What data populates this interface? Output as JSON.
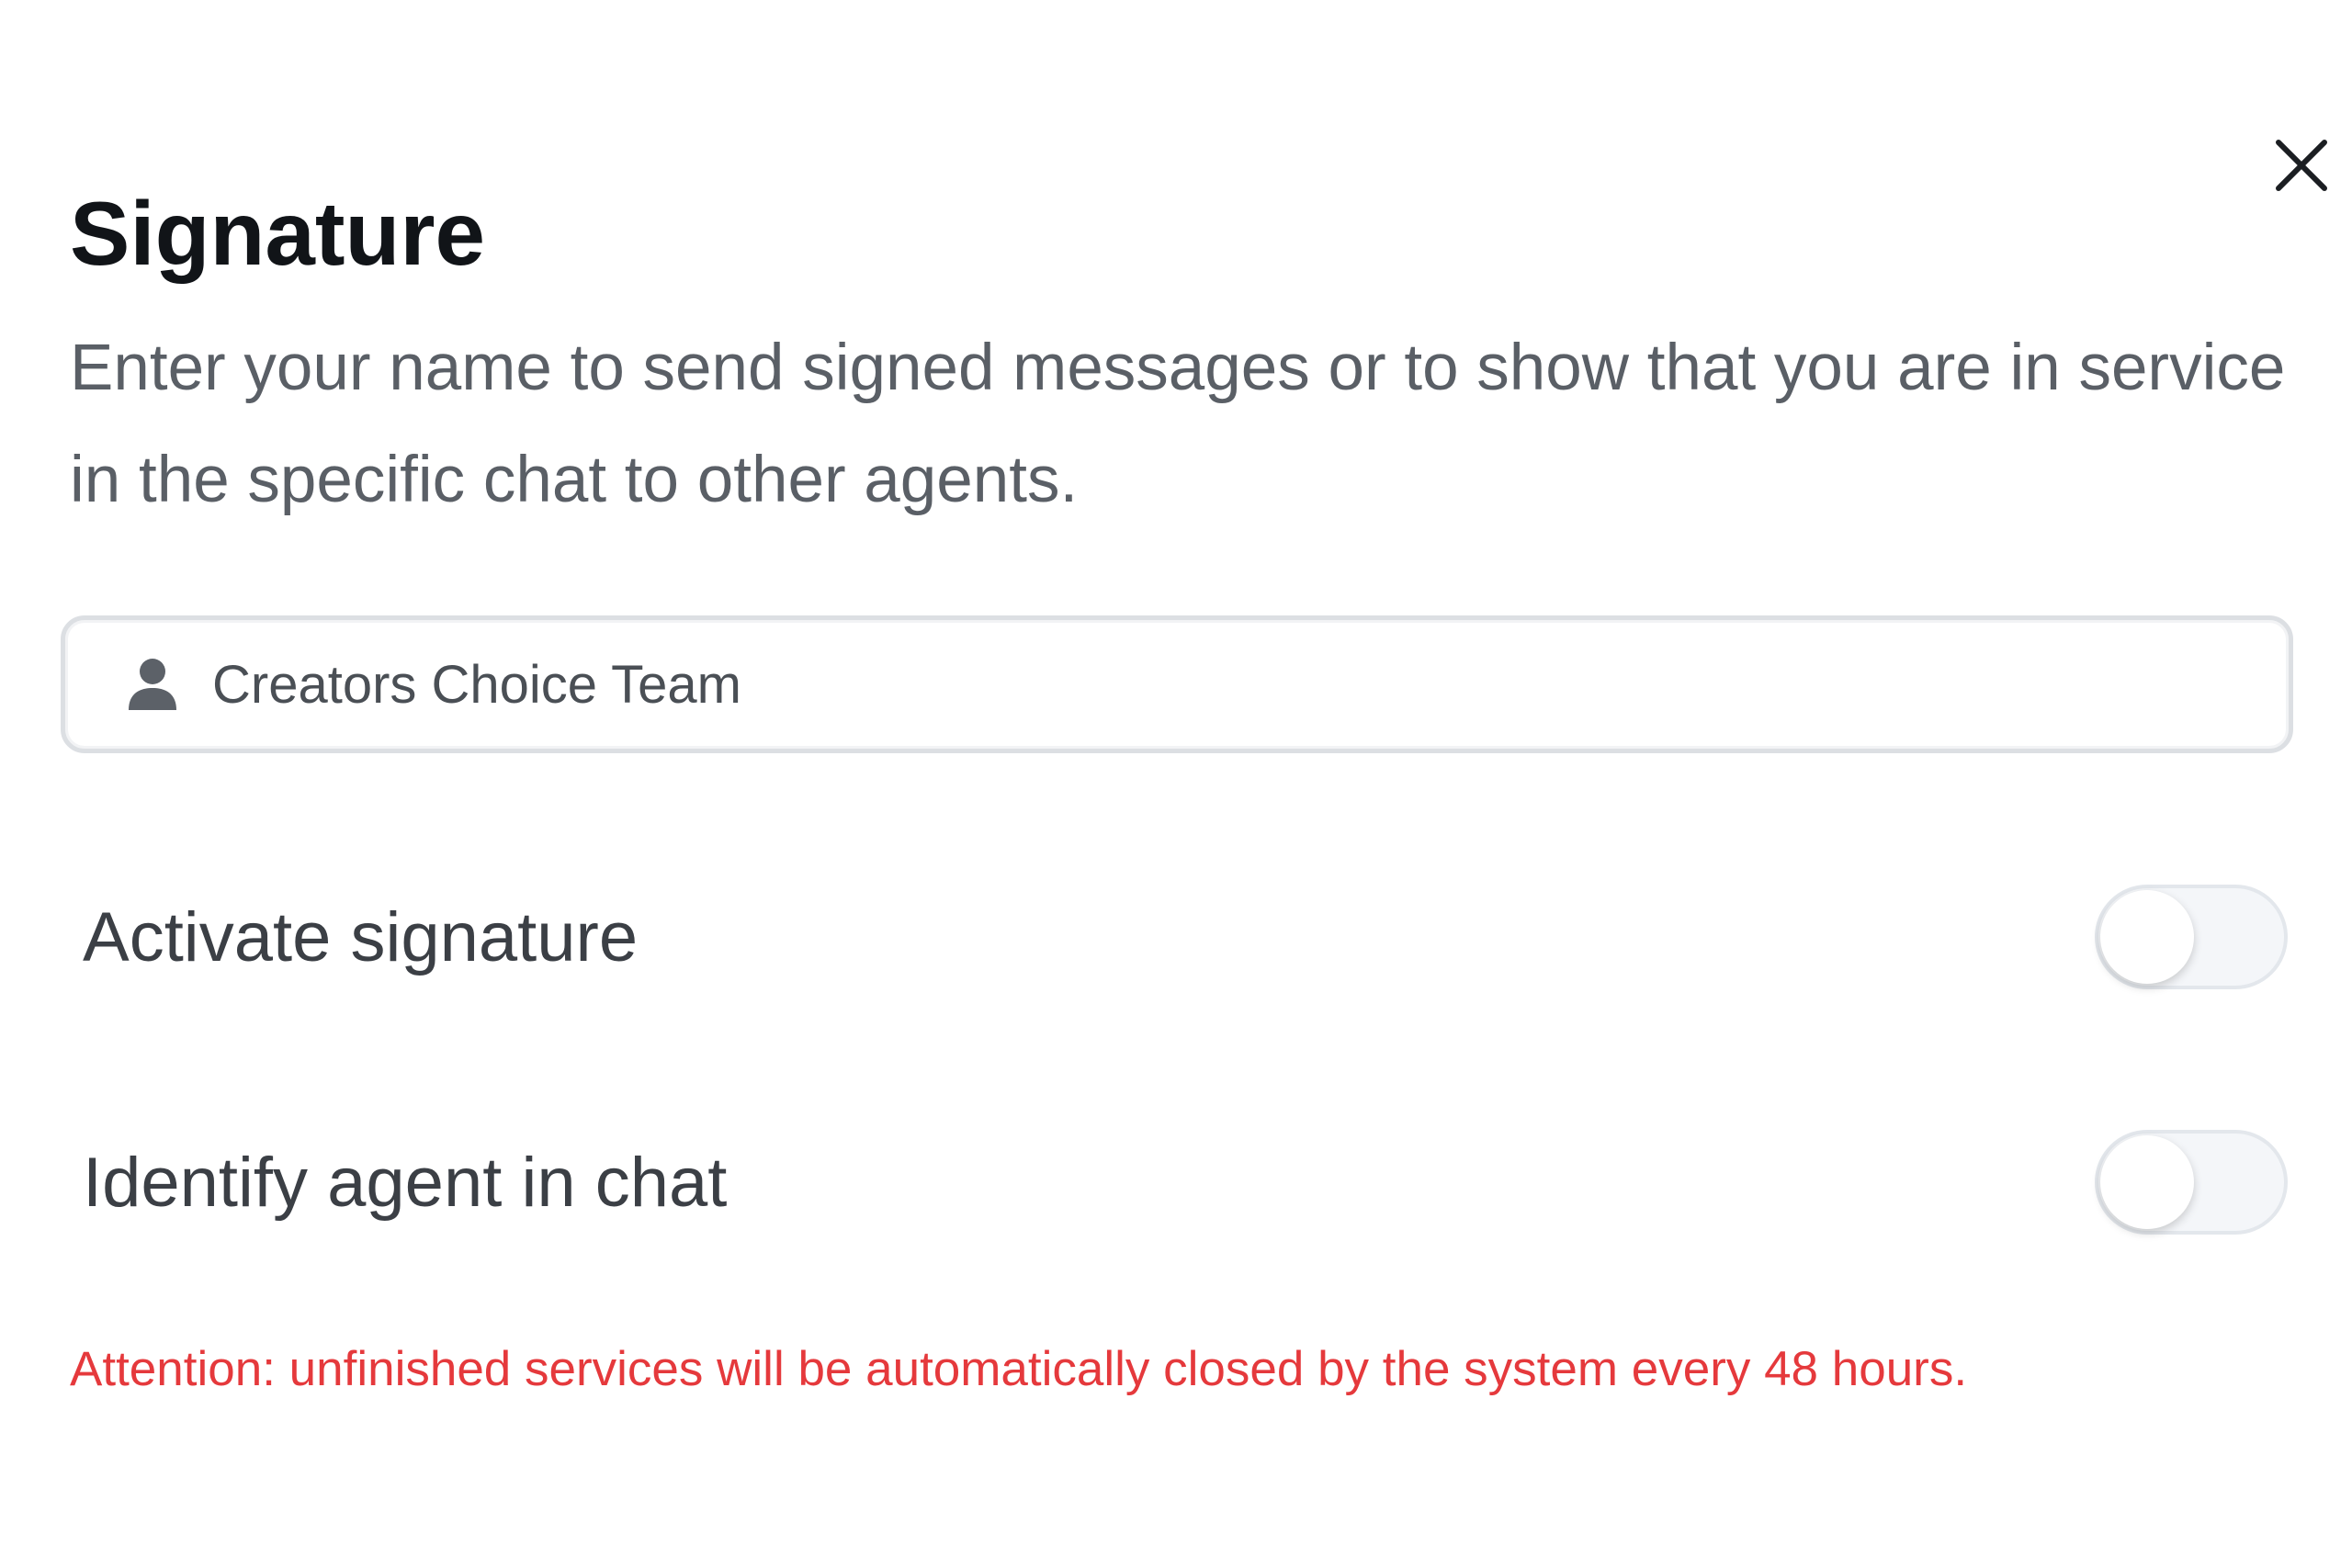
{
  "modal": {
    "title": "Signature",
    "description": "Enter your name to send signed messages or to show that you are in service in the specific chat to other agents.",
    "close_icon": "close-icon"
  },
  "signature_input": {
    "value": "Creators Choice Team",
    "placeholder": "",
    "icon": "user-icon"
  },
  "toggles": [
    {
      "label": "Activate signature",
      "checked": false
    },
    {
      "label": "Identify agent in chat",
      "checked": false
    }
  ],
  "attention_text": "Attention: unfinished services will be automatically closed by the system every 48 hours.",
  "colors": {
    "title": "#111418",
    "description": "#5a5f66",
    "attention": "#e5393c",
    "toggle_off": "#f4f6f9"
  }
}
